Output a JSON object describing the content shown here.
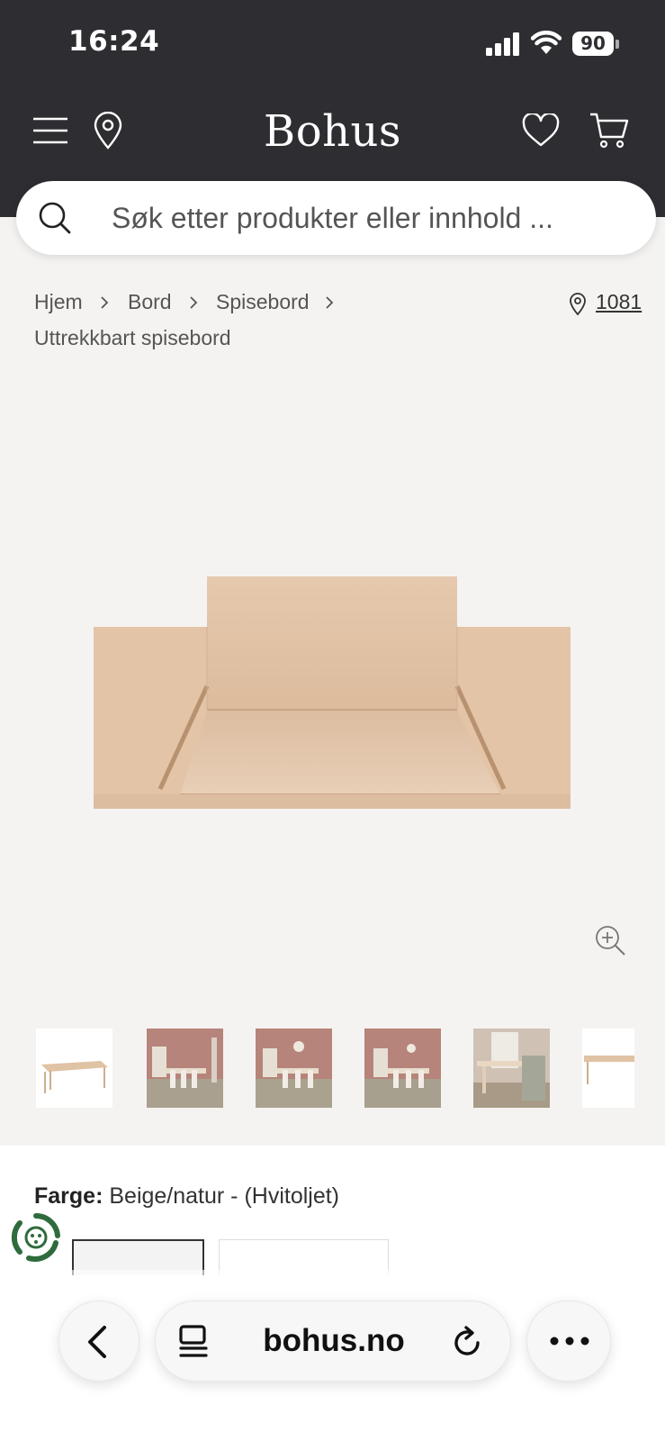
{
  "status_bar": {
    "time": "16:24",
    "battery": "90"
  },
  "header": {
    "logo": "Bohus"
  },
  "search": {
    "placeholder": "Søk etter produkter eller innhold ..."
  },
  "breadcrumb": {
    "items": [
      "Hjem",
      "Bord",
      "Spisebord"
    ],
    "current": "Uttrekkbart spisebord"
  },
  "store": {
    "number": "1081"
  },
  "product": {
    "color_label": "Farge:",
    "color_value": "Beige/natur - (Hvitoljet)"
  },
  "browser": {
    "url": "bohus.no"
  },
  "colors": {
    "header_bg": "#2e2d32",
    "page_bg": "#f5f3f1",
    "wood": "#e3c5a9"
  },
  "icons": [
    "menu-icon",
    "location-pin-icon",
    "heart-icon",
    "cart-icon",
    "search-icon",
    "zoom-in-icon",
    "eco-icon",
    "chevron-left-icon",
    "reader-icon",
    "reload-icon",
    "more-icon"
  ]
}
